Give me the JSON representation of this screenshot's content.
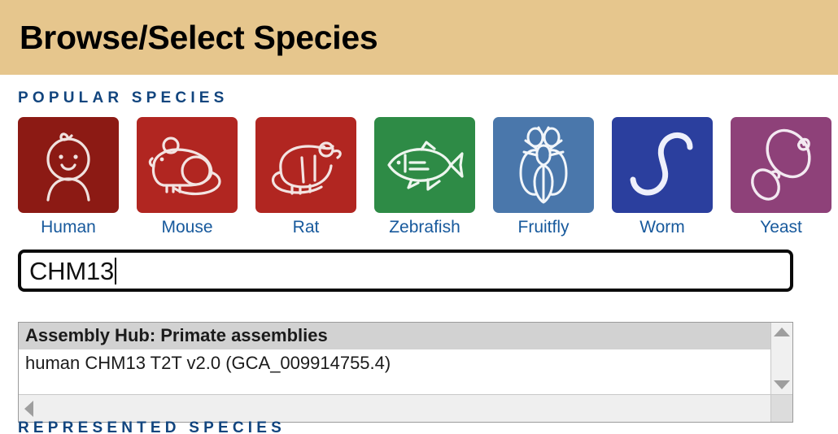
{
  "header": {
    "title": "Browse/Select Species",
    "background_color": "#e6c68d",
    "text_color": "#000000"
  },
  "popular_species": {
    "section_label": "POPULAR SPECIES",
    "label_color": "#12457e",
    "items": [
      {
        "label": "Human",
        "icon": "baby-face-icon",
        "tile_color": "#8c1a14"
      },
      {
        "label": "Mouse",
        "icon": "mouse-icon",
        "tile_color": "#b12621"
      },
      {
        "label": "Rat",
        "icon": "rat-icon",
        "tile_color": "#b12621"
      },
      {
        "label": "Zebrafish",
        "icon": "fish-icon",
        "tile_color": "#2e8b46"
      },
      {
        "label": "Fruitfly",
        "icon": "fly-icon",
        "tile_color": "#4a77ab"
      },
      {
        "label": "Worm",
        "icon": "worm-icon",
        "tile_color": "#2b3f9e"
      },
      {
        "label": "Yeast",
        "icon": "yeast-cell-icon",
        "tile_color": "#8e4179"
      }
    ]
  },
  "search": {
    "value": "CHM13",
    "placeholder": "",
    "border_color": "#0a0a0a"
  },
  "dropdown": {
    "groups": [
      {
        "header": "Assembly Hub: Primate assemblies",
        "options": [
          "human CHM13 T2T v2.0 (GCA_009914755.4)"
        ]
      }
    ],
    "scroll_up_icon": "triangle-up-icon",
    "scroll_down_icon": "triangle-down-icon",
    "scroll_left_icon": "triangle-left-icon",
    "scroll_right_icon": "triangle-right-icon"
  },
  "clipped_below": {
    "text": "REPRESENTED SPECIES"
  }
}
